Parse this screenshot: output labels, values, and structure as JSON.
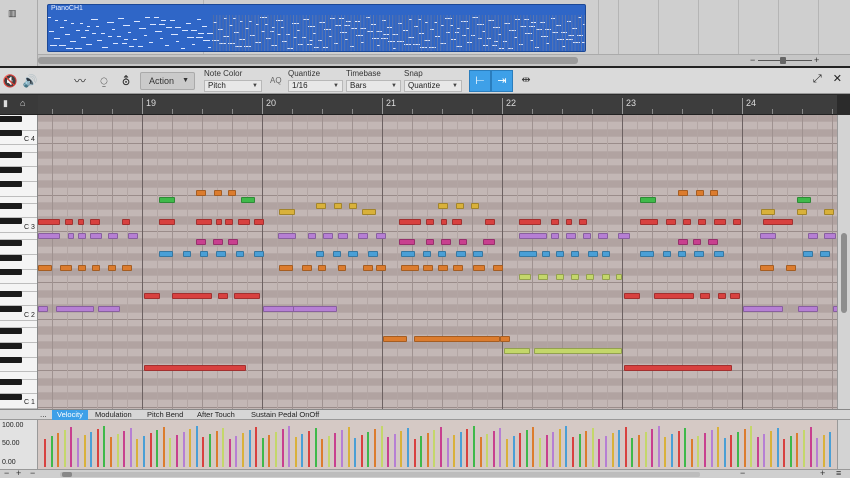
{
  "arrange": {
    "part_label": "PianoCH1"
  },
  "toolbar": {
    "action_label": "Action",
    "note_color": {
      "label": "Note Color",
      "value": "Pitch"
    },
    "aq_label": "AQ",
    "quantize": {
      "label": "Quantize",
      "value": "1/16"
    },
    "timebase": {
      "label": "Timebase",
      "value": "Bars"
    },
    "snap": {
      "label": "Snap",
      "value": "Quantize"
    },
    "window_buttons": {
      "restore": "⤢",
      "close": "✕"
    }
  },
  "ruler": {
    "bars": [
      "19",
      "20",
      "21",
      "22",
      "23",
      "24"
    ]
  },
  "keyboard": {
    "octave_labels": [
      "C 4",
      "C 3",
      "C 2",
      "C 1"
    ]
  },
  "controller_lane": {
    "more": "...",
    "tabs": [
      "Velocity",
      "Modulation",
      "Pitch Bend",
      "After Touch",
      "Sustain Pedal OnOff"
    ],
    "active_tab": "Velocity",
    "scale": [
      "100.00",
      "50.00",
      "0.00"
    ]
  },
  "colors": {
    "accent": "#3ea0e8",
    "part": "#2f66c7",
    "note_red": "#d8413f",
    "note_orange": "#dc7c2e",
    "note_lavender": "#b67fd4",
    "note_blue": "#4a9fd6",
    "note_magenta": "#c8408f",
    "note_green": "#3fb94a",
    "note_yellow": "#d9b13a",
    "note_lime": "#c4d76a"
  }
}
